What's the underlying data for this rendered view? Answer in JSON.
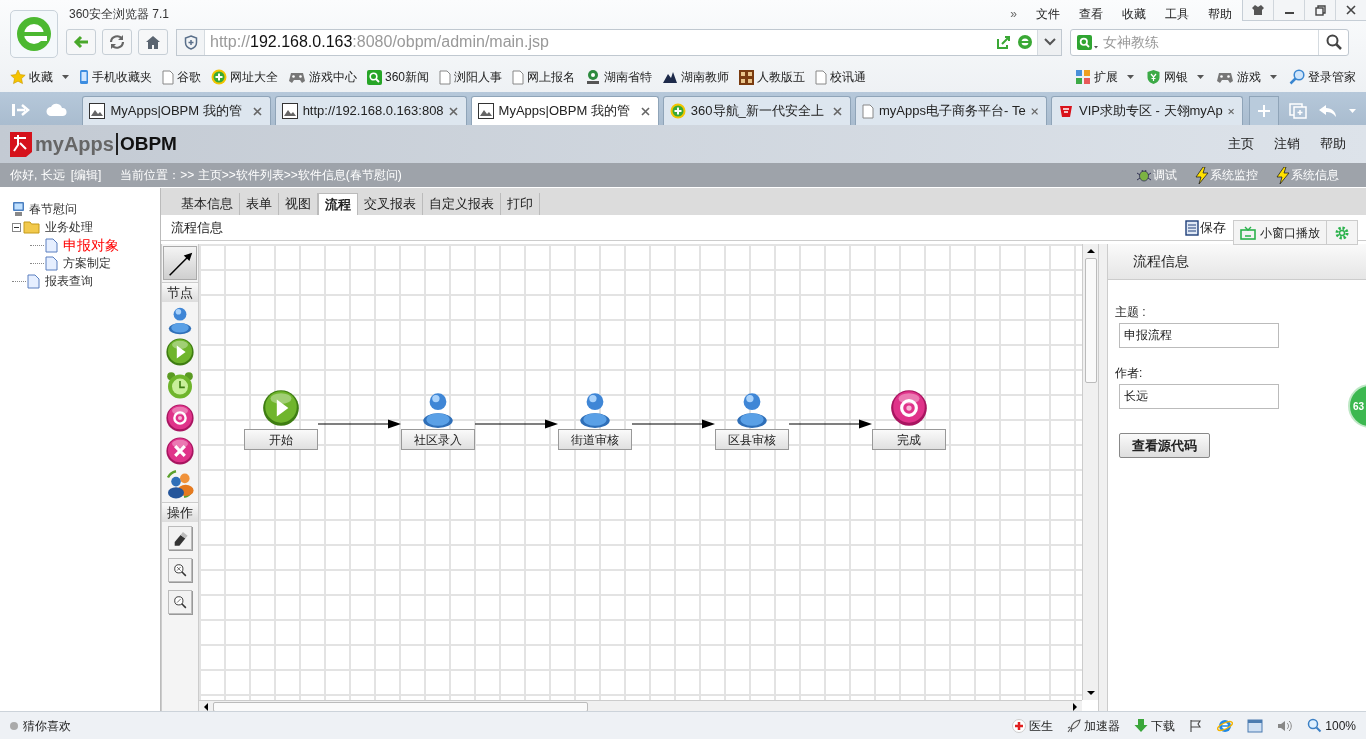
{
  "browser": {
    "title": "360安全浏览器 7.1",
    "menu_more": "»",
    "menu": [
      "文件",
      "查看",
      "收藏",
      "工具",
      "帮助"
    ],
    "url_scheme": "http://",
    "url_host": "192.168.0.163",
    "url_path": ":8080/obpm/admin/main.jsp",
    "search": {
      "placeholder": "女神教练"
    },
    "bookmarks": [
      {
        "kind": "star",
        "text": "收藏",
        "dropdown": true
      },
      {
        "kind": "phone",
        "text": "手机收藏夹",
        "dropdown": false
      },
      {
        "kind": "page",
        "text": "谷歌",
        "dropdown": false
      },
      {
        "kind": "plus",
        "text": "网址大全",
        "dropdown": false
      },
      {
        "kind": "gamepad",
        "text": "游戏中心",
        "dropdown": false
      },
      {
        "kind": "search",
        "text": "360新闻",
        "dropdown": false
      },
      {
        "kind": "page",
        "text": "浏阳人事",
        "dropdown": false
      },
      {
        "kind": "page",
        "text": "网上报名",
        "dropdown": false
      },
      {
        "kind": "seal",
        "text": "湖南省特",
        "dropdown": false
      },
      {
        "kind": "emblem",
        "text": "湖南教师",
        "dropdown": false
      },
      {
        "kind": "grid",
        "text": "人教版五",
        "dropdown": false
      },
      {
        "kind": "page",
        "text": "校讯通",
        "dropdown": false
      }
    ],
    "tools": [
      {
        "kind": "tiles",
        "text": "扩展",
        "dropdown": true
      },
      {
        "kind": "shield",
        "text": "网银",
        "dropdown": true
      },
      {
        "kind": "gamepad",
        "text": "游戏",
        "dropdown": true
      },
      {
        "kind": "magnifier",
        "text": "登录管家",
        "dropdown": false
      }
    ],
    "tabs": [
      {
        "kind": "image",
        "title": "MyApps|OBPM 我的管",
        "selected": false
      },
      {
        "kind": "image",
        "title": "http://192.168.0.163:808",
        "selected": false
      },
      {
        "kind": "image",
        "title": "MyApps|OBPM 我的管",
        "selected": true
      },
      {
        "kind": "plus",
        "title": "360导航_新一代安全上",
        "selected": false
      },
      {
        "kind": "page",
        "title": "myApps电子商务平台- Te",
        "selected": false
      },
      {
        "kind": "logo",
        "title": "VIP求助专区 - 天翎myAp",
        "selected": false
      }
    ]
  },
  "app": {
    "logo_text": "myApps",
    "logo_product": "OBPM",
    "nav": [
      "主页",
      "注销",
      "帮助"
    ],
    "greeting": "你好, 长远",
    "edit_link": "[编辑]",
    "location": "当前位置：>> 主页>>软件列表>>软件信息(春节慰问)",
    "actions": [
      {
        "kind": "bug",
        "text": "调试"
      },
      {
        "kind": "bolt",
        "text": "系统监控"
      },
      {
        "kind": "bolt",
        "text": "系统信息"
      }
    ]
  },
  "tree": {
    "label": "春节慰问",
    "children": [
      {
        "label": "业务处理",
        "expanded": true,
        "selected": false,
        "children": [
          {
            "label": "申报对象",
            "selected": true
          },
          {
            "label": "方案制定",
            "selected": false
          }
        ]
      },
      {
        "label": "报表查询",
        "selected": false
      }
    ]
  },
  "tabs": [
    {
      "label": "基本信息",
      "selected": false
    },
    {
      "label": "表单",
      "selected": false
    },
    {
      "label": "视图",
      "selected": false
    },
    {
      "label": "流程",
      "selected": true
    },
    {
      "label": "交叉报表",
      "selected": false
    },
    {
      "label": "自定义报表",
      "selected": false
    },
    {
      "label": "打印",
      "selected": false
    }
  ],
  "toolbar": {
    "title": "流程信息",
    "save": "保存"
  },
  "palette": [
    {
      "kind": "pointer"
    },
    {
      "kind": "heading",
      "text": "节点"
    },
    {
      "kind": "person"
    },
    {
      "kind": "start"
    },
    {
      "kind": "timer"
    },
    {
      "kind": "end"
    },
    {
      "kind": "abort"
    },
    {
      "kind": "group"
    },
    {
      "kind": "heading",
      "text": "操作"
    },
    {
      "kind": "eraser"
    },
    {
      "kind": "zoom-in"
    },
    {
      "kind": "zoom-out"
    }
  ],
  "flow": {
    "nodes": [
      {
        "kind": "start",
        "label": "开始"
      },
      {
        "kind": "person",
        "label": "社区录入"
      },
      {
        "kind": "person",
        "label": "街道审核"
      },
      {
        "kind": "person",
        "label": "区县审核"
      },
      {
        "kind": "end",
        "label": "完成"
      }
    ]
  },
  "panel": {
    "title": "流程信息",
    "fields": [
      {
        "label": "主题 :",
        "value": "申报流程"
      },
      {
        "label": "作者:",
        "value": "长远"
      }
    ],
    "button": "查看源代码"
  },
  "overlay": {
    "mini_player": "小窗口播放",
    "badge": "63"
  },
  "status_bar": {
    "left": "猜你喜欢",
    "items": [
      {
        "kind": "cross",
        "text": "医生"
      },
      {
        "kind": "rocket",
        "text": "加速器"
      },
      {
        "kind": "download",
        "text": "下载"
      },
      {
        "kind": "flag"
      },
      {
        "kind": "browser"
      },
      {
        "kind": "window"
      },
      {
        "kind": "speaker"
      },
      {
        "kind": "zoom",
        "text": "100%"
      }
    ]
  }
}
